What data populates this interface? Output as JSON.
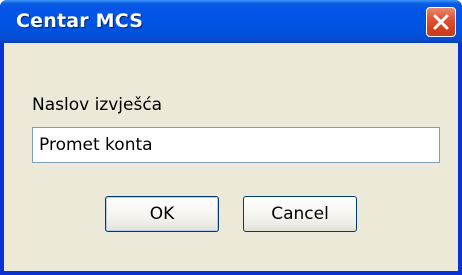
{
  "window": {
    "title": "Centar MCS",
    "close_icon": "close-icon"
  },
  "dialog": {
    "prompt_label": "Naslov izvješća",
    "input_value": "Promet konta",
    "ok_label": "OK",
    "cancel_label": "Cancel"
  },
  "colors": {
    "titlebar": "#0055e5",
    "frame": "#0831d9",
    "dialog_background": "#ece9d8",
    "close_button": "#d6411f",
    "input_border": "#7f9db9",
    "button_border": "#003c74"
  }
}
